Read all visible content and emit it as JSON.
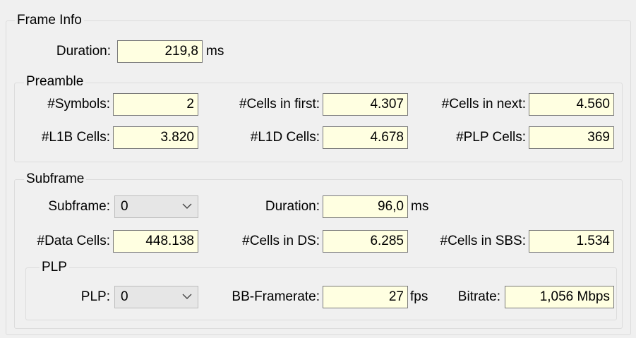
{
  "frame_info": {
    "legend": "Frame Info",
    "duration_label": "Duration:",
    "duration_value": "219,8",
    "duration_unit": "ms"
  },
  "preamble": {
    "legend": "Preamble",
    "symbols_label": "#Symbols:",
    "symbols_value": "2",
    "cells_first_label": "#Cells in first:",
    "cells_first_value": "4.307",
    "cells_next_label": "#Cells in next:",
    "cells_next_value": "4.560",
    "l1b_label": "#L1B Cells:",
    "l1b_value": "3.820",
    "l1d_label": "#L1D Cells:",
    "l1d_value": "4.678",
    "plp_cells_label": "#PLP Cells:",
    "plp_cells_value": "369"
  },
  "subframe": {
    "legend": "Subframe",
    "subframe_label": "Subframe:",
    "subframe_selected": "0",
    "duration_label": "Duration:",
    "duration_value": "96,0",
    "duration_unit": "ms",
    "data_cells_label": "#Data Cells:",
    "data_cells_value": "448.138",
    "cells_ds_label": "#Cells in DS:",
    "cells_ds_value": "6.285",
    "cells_sbs_label": "#Cells in SBS:",
    "cells_sbs_value": "1.534"
  },
  "plp": {
    "legend": "PLP",
    "plp_label": "PLP:",
    "plp_selected": "0",
    "bb_framerate_label": "BB-Framerate:",
    "bb_framerate_value": "27",
    "bb_framerate_unit": "fps",
    "bitrate_label": "Bitrate:",
    "bitrate_value": "1,056 Mbps"
  },
  "icons": {
    "dropdown": "chevron-down-icon"
  },
  "colors": {
    "value_bg": "#ffffe1",
    "panel_bg": "#f0f0f0"
  }
}
